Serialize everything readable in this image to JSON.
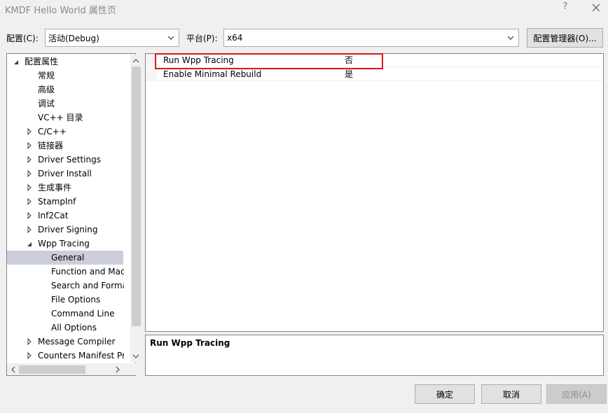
{
  "window": {
    "title": "KMDF Hello World 属性页",
    "help": "?"
  },
  "toolbar": {
    "config_label": "配置(C):",
    "config_value": "活动(Debug)",
    "platform_label": "平台(P):",
    "platform_value": "x64",
    "config_manager": "配置管理器(O)..."
  },
  "tree": {
    "items": [
      {
        "label": "配置属性",
        "level": 0,
        "state": "expanded"
      },
      {
        "label": "常规",
        "level": 1,
        "state": "leaf"
      },
      {
        "label": "高级",
        "level": 1,
        "state": "leaf"
      },
      {
        "label": "调试",
        "level": 1,
        "state": "leaf"
      },
      {
        "label": "VC++ 目录",
        "level": 1,
        "state": "leaf"
      },
      {
        "label": "C/C++",
        "level": 1,
        "state": "collapsed"
      },
      {
        "label": "链接器",
        "level": 1,
        "state": "collapsed"
      },
      {
        "label": "Driver Settings",
        "level": 1,
        "state": "collapsed"
      },
      {
        "label": "Driver Install",
        "level": 1,
        "state": "collapsed"
      },
      {
        "label": "生成事件",
        "level": 1,
        "state": "collapsed"
      },
      {
        "label": "StampInf",
        "level": 1,
        "state": "collapsed"
      },
      {
        "label": "Inf2Cat",
        "level": 1,
        "state": "collapsed"
      },
      {
        "label": "Driver Signing",
        "level": 1,
        "state": "collapsed"
      },
      {
        "label": "Wpp Tracing",
        "level": 1,
        "state": "expanded"
      },
      {
        "label": "General",
        "level": 2,
        "state": "leaf",
        "selected": true
      },
      {
        "label": "Function and Macro Options",
        "level": 2,
        "state": "leaf"
      },
      {
        "label": "Search and Formatting",
        "level": 2,
        "state": "leaf"
      },
      {
        "label": "File Options",
        "level": 2,
        "state": "leaf"
      },
      {
        "label": "Command Line",
        "level": 2,
        "state": "leaf"
      },
      {
        "label": "All Options",
        "level": 2,
        "state": "leaf"
      },
      {
        "label": "Message Compiler",
        "level": 1,
        "state": "collapsed"
      },
      {
        "label": "Counters Manifest Preprocessor",
        "level": 1,
        "state": "collapsed"
      }
    ]
  },
  "grid": {
    "rows": [
      {
        "name": "Run Wpp Tracing",
        "value": "否"
      },
      {
        "name": "Enable Minimal Rebuild",
        "value": "是"
      }
    ]
  },
  "description": {
    "title": "Run Wpp Tracing"
  },
  "buttons": {
    "ok": "确定",
    "cancel": "取消",
    "apply": "应用(A)"
  },
  "colors": {
    "selection": "#cccedb",
    "highlight_border": "#e0151b"
  }
}
